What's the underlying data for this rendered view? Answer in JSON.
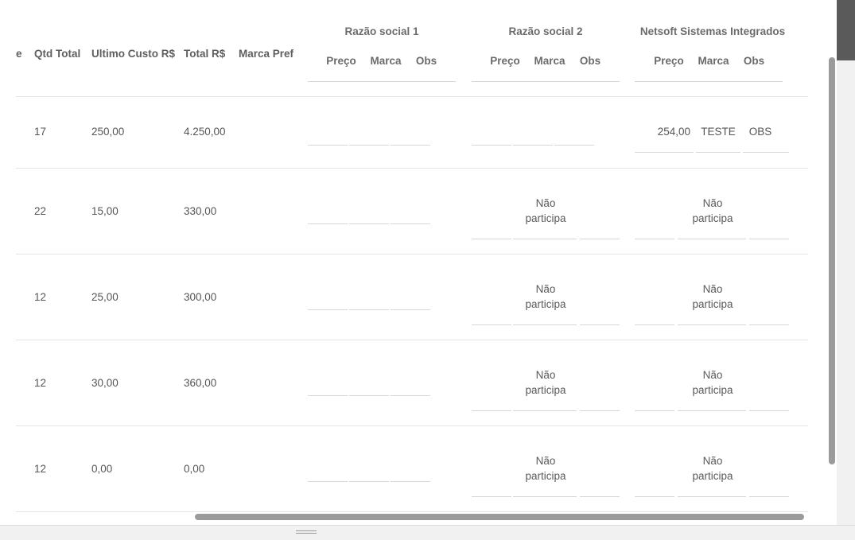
{
  "headers": {
    "truncated": "e",
    "qtd_total": "Qtd Total",
    "ultimo_custo": "Ultimo Custo R$",
    "total": "Total R$",
    "marca_pref": "Marca Pref"
  },
  "suppliers": [
    {
      "name": "Razão social 1",
      "cols": [
        "Preço",
        "Marca",
        "Obs"
      ]
    },
    {
      "name": "Razão social 2",
      "cols": [
        "Preço",
        "Marca",
        "Obs"
      ]
    },
    {
      "name": "Netsoft Sistemas Integrados",
      "cols": [
        "Preço",
        "Marca",
        "Obs"
      ]
    }
  ],
  "not_participating": [
    "Não",
    "participa"
  ],
  "rows": [
    {
      "qtd": "17",
      "custo": "250,00",
      "total": "4.250,00",
      "s3": {
        "preco": "254,00",
        "marca": "TESTE",
        "obs": "OBS"
      }
    },
    {
      "qtd": "22",
      "custo": "15,00",
      "total": "330,00"
    },
    {
      "qtd": "12",
      "custo": "25,00",
      "total": "300,00"
    },
    {
      "qtd": "12",
      "custo": "30,00",
      "total": "360,00"
    },
    {
      "qtd": "12",
      "custo": "0,00",
      "total": "0,00"
    }
  ],
  "colors": {
    "header_text": "#5f5f5f",
    "row_divider": "#e4e4e4",
    "scrollbar_thumb": "#9b9b9b"
  }
}
